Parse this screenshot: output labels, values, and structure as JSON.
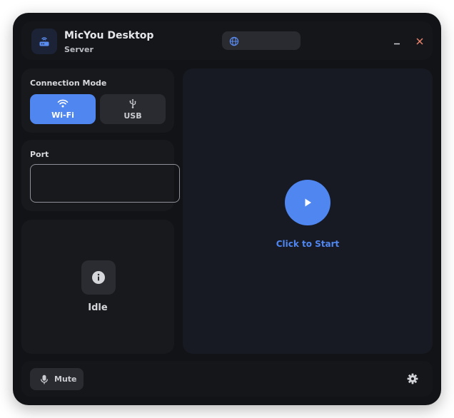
{
  "app": {
    "title": "MicYou Desktop",
    "subtitle": "Server",
    "icon": "router-icon",
    "accent_color": "#4f86f0"
  },
  "header": {
    "language_icon": "globe-icon",
    "language_value": "",
    "minimize_icon": "minimize-icon",
    "close_icon": "close-icon",
    "close_color": "#e8836b"
  },
  "connection_mode": {
    "label": "Connection Mode",
    "options": [
      {
        "label": "Wi-Fi",
        "icon": "wifi-icon",
        "selected": true
      },
      {
        "label": "USB",
        "icon": "usb-icon",
        "selected": false
      }
    ]
  },
  "port": {
    "label": "Port",
    "value": "",
    "placeholder": ""
  },
  "status": {
    "icon": "info-icon",
    "text": "Idle"
  },
  "main": {
    "start_icon": "play-icon",
    "start_text": "Click to Start"
  },
  "bottom": {
    "mute_label": "Mute",
    "mute_icon": "microphone-icon",
    "settings_icon": "gear-icon"
  }
}
